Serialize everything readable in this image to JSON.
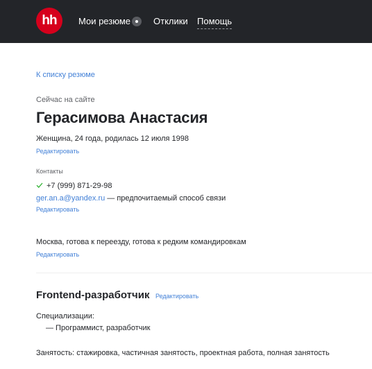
{
  "header": {
    "logo_text": "hh",
    "nav": {
      "resumes": "Мои резюме",
      "responses": "Отклики",
      "help": "Помощь"
    }
  },
  "resume": {
    "back_link": "К списку резюме",
    "online_status": "Сейчас на сайте",
    "name": "Герасимова Анастасия",
    "personal_info": "Женщина, 24 года, родилась 12 июля 1998",
    "edit_label": "Редактировать",
    "contacts_label": "Контакты",
    "phone": "+7 (999) 871-29-98",
    "email": "ger.an.a@yandex.ru",
    "email_note": " — предпочитаемый способ связи",
    "location": "Москва, готова к переезду, готова к редким командировкам",
    "position_title": "Frontend-разработчик",
    "specializations_label": "Специализации:",
    "specialization_item": "— Программист, разработчик",
    "employment": "Занятость: стажировка, частичная занятость, проектная работа, полная занятость"
  },
  "colors": {
    "header_bg": "#232529",
    "logo_bg": "#d6001c",
    "link": "#4280d7",
    "check": "#30b333"
  }
}
